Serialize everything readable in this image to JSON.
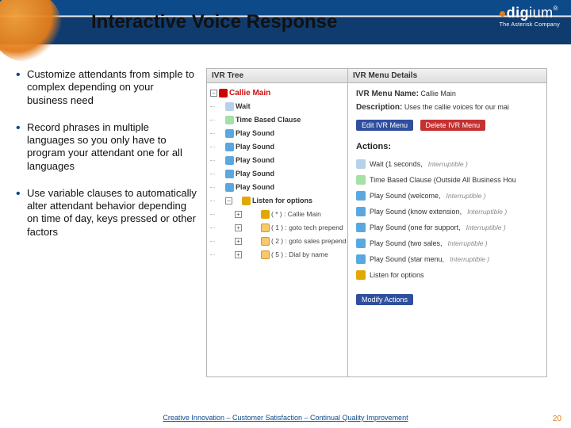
{
  "header": {
    "title": "Interactive Voice Response",
    "brand_prefix": "dig",
    "brand_suffix": "ium",
    "brand_reg": "®",
    "tagline": "The Asterisk Company"
  },
  "bullets": [
    "Customize attendants from simple to complex depending on your business need",
    "Record phrases in multiple languages so you only have to program your attendant one for all languages",
    "Use variable clauses to automatically alter attendant behavior depending on time of day, keys pressed or other factors"
  ],
  "app": {
    "tree_header": "IVR Tree",
    "details_header": "IVR Menu Details",
    "tree": {
      "root": "Callie Main",
      "items": [
        {
          "icon": "wait",
          "label": "Wait"
        },
        {
          "icon": "time",
          "label": "Time Based Clause"
        },
        {
          "icon": "play",
          "label": "Play Sound"
        },
        {
          "icon": "play",
          "label": "Play Sound"
        },
        {
          "icon": "play",
          "label": "Play Sound"
        },
        {
          "icon": "play",
          "label": "Play Sound"
        },
        {
          "icon": "play",
          "label": "Play Sound"
        },
        {
          "icon": "listen",
          "label": "Listen for options"
        },
        {
          "icon": "star",
          "label": "( * ) : Callie Main",
          "depth": 2,
          "sub": true
        },
        {
          "icon": "fold",
          "label": "( 1 ) : goto tech prepend",
          "depth": 2,
          "sub": true
        },
        {
          "icon": "fold",
          "label": "( 2 ) : goto sales prepend",
          "depth": 2,
          "sub": true
        },
        {
          "icon": "fold",
          "label": "( 5 ) : Dial by name",
          "depth": 2,
          "sub": true
        }
      ]
    },
    "details": {
      "name_label": "IVR Menu Name:",
      "name_value": "Callie Main",
      "desc_label": "Description:",
      "desc_value": "Uses the callie voices for our mai",
      "edit_btn": "Edit IVR Menu",
      "delete_btn": "Delete IVR Menu",
      "actions_label": "Actions:",
      "actions": [
        {
          "icon": "wait",
          "text": "Wait (1 seconds,",
          "mut": "Interruptible )"
        },
        {
          "icon": "time",
          "text": "Time Based Clause (Outside All Business Hou",
          "mut": ""
        },
        {
          "icon": "play",
          "text": "Play Sound (welcome,",
          "mut": "Interruptible )"
        },
        {
          "icon": "play",
          "text": "Play Sound (know extension,",
          "mut": "Interruptible )"
        },
        {
          "icon": "play",
          "text": "Play Sound (one for support,",
          "mut": "Interruptible )"
        },
        {
          "icon": "play",
          "text": "Play Sound (two sales,",
          "mut": "Interruptible )"
        },
        {
          "icon": "play",
          "text": "Play Sound (star menu,",
          "mut": "Interruptible )"
        },
        {
          "icon": "listen",
          "text": "Listen for options",
          "mut": ""
        }
      ],
      "modify_btn": "Modify Actions"
    }
  },
  "footer": {
    "text": "Creative Innovation – Customer Satisfaction – Continual Quality Improvement",
    "page": "20"
  }
}
